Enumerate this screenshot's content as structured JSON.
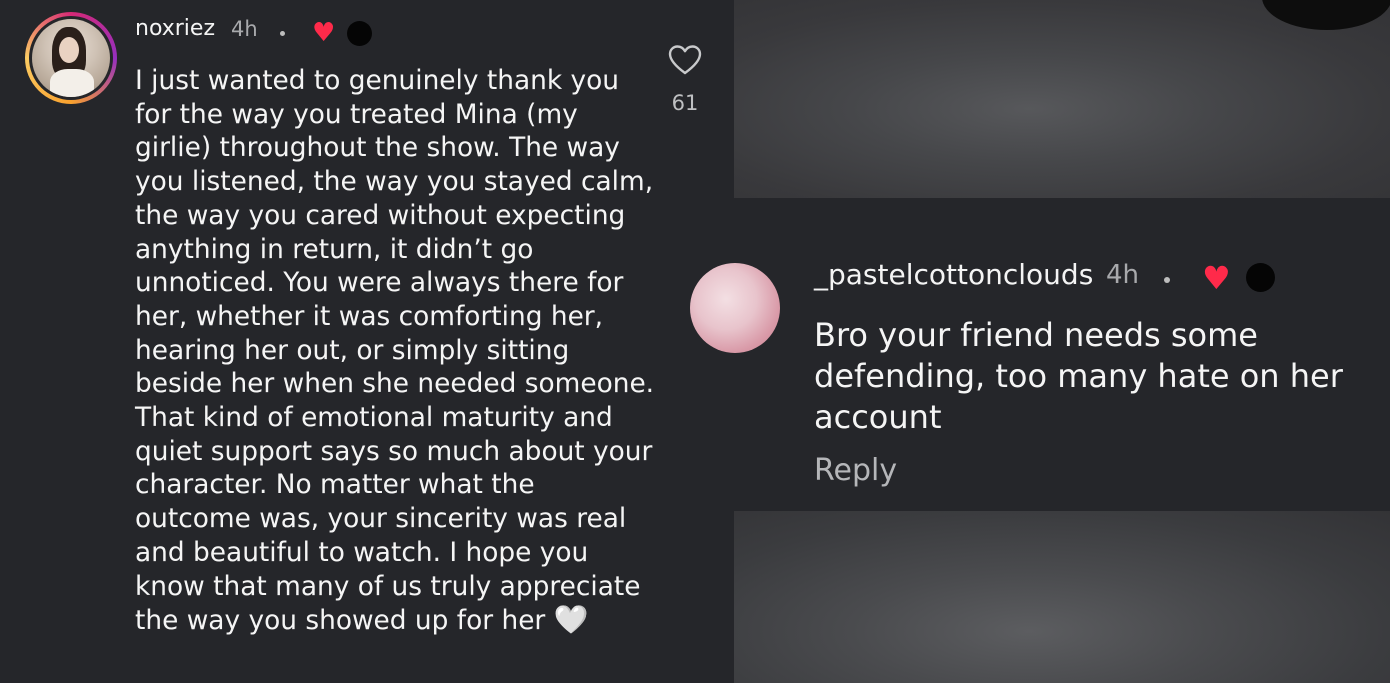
{
  "comments": [
    {
      "username": "noxriez",
      "time": "4h",
      "separator": "•",
      "text": "I just wanted to genuinely thank you for the way you treated Mina (my girlie) throughout the show. The way you listened, the way you stayed calm, the way you cared without expecting anything in return, it didn’t go unnoticed. You were always there for her, whether it was comforting her, hearing her out, or simply sitting beside her when she needed someone. That kind of emotional maturity and quiet support says so much about your character. No matter what the outcome was, your sincerity was real and beautiful to watch. I hope you know that many of us truly appreciate the way you showed up for her",
      "emoji": "🤍",
      "like_count": "61",
      "badge_heart": "♥"
    },
    {
      "username": "_pastelcottonclouds",
      "time": "4h",
      "separator": "•",
      "text": "Bro your friend needs some defending, too many hate on her account",
      "reply_label": "Reply",
      "badge_heart": "♥"
    }
  ],
  "colors": {
    "background": "#25262a",
    "heart_red": "#ff2a4a",
    "muted_text": "#a8a9ac"
  },
  "icons": {
    "like": "heart-outline-icon"
  }
}
